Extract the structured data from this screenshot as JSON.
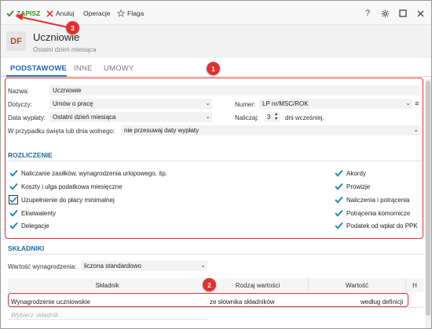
{
  "toolbar": {
    "save_label": "ZAPISZ",
    "cancel_label": "Anuluj",
    "operations_label": "Operacje",
    "flag_label": "Flaga",
    "help_label": "?"
  },
  "header": {
    "avatar_initials": "DF",
    "title": "Uczniowie",
    "subtitle": "Ostatni dzień miesiąca"
  },
  "tabs": [
    {
      "label": "PODSTAWOWE",
      "active": true
    },
    {
      "label": "INNE",
      "active": false
    },
    {
      "label": "UMOWY",
      "active": false
    }
  ],
  "form": {
    "name_label": "Nazwa:",
    "name_value": "Uczniowie",
    "applies_label": "Dotyczy:",
    "applies_value": "Umów o pracę",
    "number_label": "Numer:",
    "number_value": "LP nr/MSC/ROK",
    "payout_date_label": "Data wypłaty:",
    "payout_date_value": "Ostatni dzień miesiąca",
    "accrue_label": "Naliczaj:",
    "accrue_value": "3",
    "accrue_suffix": "dni wcześniej.",
    "holiday_label": "W przypadku święta lub dnia wolnego:",
    "holiday_value": "nie przesuwaj daty wypłaty"
  },
  "settlements": {
    "title": "ROZLICZENIE",
    "left": [
      {
        "label": "Naliczanie zasiłków, wynagrodzenia urlopowego, itp.",
        "checked": true
      },
      {
        "label": "Koszty i ulga podatkowa miesięczne",
        "checked": true
      },
      {
        "label": "Uzupełnienie do płacy minimalnej",
        "checked": true
      },
      {
        "label": "Ekwiwalenty",
        "checked": true
      },
      {
        "label": "Delegacje",
        "checked": true
      }
    ],
    "right": [
      {
        "label": "Akordy",
        "checked": true
      },
      {
        "label": "Prowizje",
        "checked": true
      },
      {
        "label": "Naliczenia i potrącenia",
        "checked": true
      },
      {
        "label": "Potrącenia komornicze",
        "checked": true
      },
      {
        "label": "Podatek od wpłat do PPK",
        "checked": true
      }
    ]
  },
  "components": {
    "title": "SKŁADNIKI",
    "value_label": "Wartość wynagrodzenia:",
    "value_select": "liczona standardowo",
    "columns": [
      "Składnik",
      "Rodzaj wartości",
      "Wartość",
      "H"
    ],
    "rows": [
      {
        "component": "Wynagrodzenie uczniowskie",
        "value_type": "ze słownika składników",
        "value": "według definicji"
      }
    ],
    "new_row_placeholder": "Wybierz składnik..."
  },
  "callouts": [
    "1",
    "2",
    "3"
  ],
  "colors": {
    "accent": "#1b6aa5",
    "save_green": "#3a8f2e",
    "cancel_red": "#d83a3a",
    "check_blue": "#1b84c6",
    "callout_red": "#e03131"
  }
}
